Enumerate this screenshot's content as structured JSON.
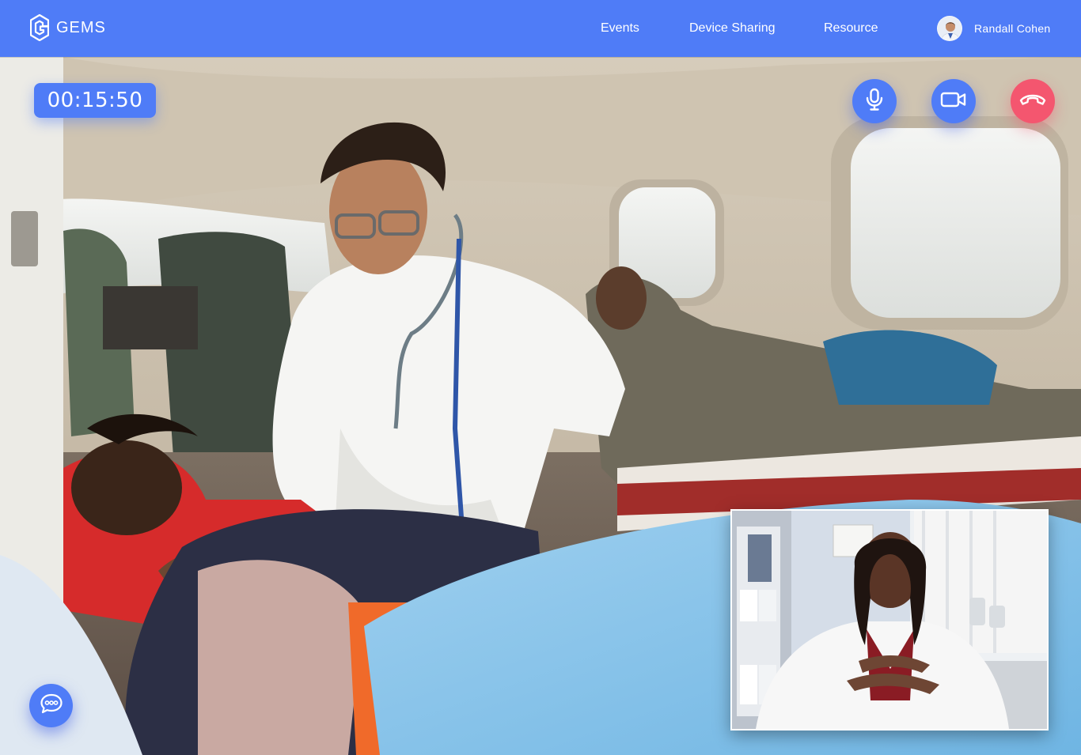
{
  "app": {
    "name": "GEMS"
  },
  "nav": {
    "items": [
      {
        "label": "Events"
      },
      {
        "label": "Device Sharing"
      },
      {
        "label": "Resource"
      }
    ]
  },
  "user": {
    "name": "Randall Cohen"
  },
  "call": {
    "timer": "00:15:50"
  },
  "icons": {
    "logo": "gems-logo-icon",
    "mic": "microphone-icon",
    "camera": "video-camera-icon",
    "hangup": "phone-hangup-icon",
    "chat": "chat-bubble-icon"
  },
  "colors": {
    "accent": "#4f7cf7",
    "hangup": "#f4566f"
  }
}
